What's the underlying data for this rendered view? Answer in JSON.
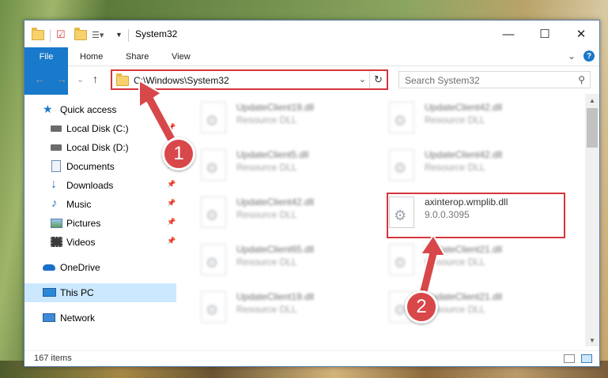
{
  "window": {
    "title": "System32",
    "controls": {
      "minimize": "—",
      "maximize": "☐",
      "close": "✕"
    }
  },
  "ribbon": {
    "tabs": [
      "File",
      "Home",
      "Share",
      "View"
    ],
    "expand": "⌄",
    "help": "?"
  },
  "nav": {
    "back": "←",
    "forward": "→",
    "recent": "⌄",
    "up": "↑"
  },
  "address": {
    "path": "C:\\Windows\\System32",
    "dropdown": "⌄",
    "refresh": "↻"
  },
  "search": {
    "placeholder": "Search System32",
    "icon": "⚲"
  },
  "sidebar": {
    "items": [
      {
        "label": "Quick access",
        "icon": "star-icon"
      },
      {
        "label": "Local Disk (C:)",
        "icon": "drive-icon",
        "pin": "📌"
      },
      {
        "label": "Local Disk (D:)",
        "icon": "drive-icon"
      },
      {
        "label": "Documents",
        "icon": "documents-icon",
        "pin": "📌"
      },
      {
        "label": "Downloads",
        "icon": "downloads-icon",
        "pin": "📌"
      },
      {
        "label": "Music",
        "icon": "music-icon",
        "pin": "📌"
      },
      {
        "label": "Pictures",
        "icon": "pictures-icon",
        "pin": "📌"
      },
      {
        "label": "Videos",
        "icon": "videos-icon",
        "pin": "📌"
      },
      {
        "label": "OneDrive",
        "icon": "onedrive-icon"
      },
      {
        "label": "This PC",
        "icon": "computer-icon",
        "selected": true
      },
      {
        "label": "Network",
        "icon": "network-icon"
      }
    ]
  },
  "files": [
    {
      "name": "UpdateClient19.dll",
      "desc": "Resource DLL"
    },
    {
      "name": "UpdateClient42.dll",
      "desc": "Resource DLL"
    },
    {
      "name": "UpdateClient5.dll",
      "desc": "Resource DLL"
    },
    {
      "name": "UpdateClient42.dll",
      "desc": "Resource DLL"
    },
    {
      "name": "UpdateClient42.dll",
      "desc": "Resource DLL"
    },
    {
      "name": "axinterop.wmplib.dll",
      "desc": "9.0.0.3095"
    },
    {
      "name": "UpdateClient65.dll",
      "desc": "Resource DLL"
    },
    {
      "name": "UpdateClient21.dll",
      "desc": "Resource DLL"
    },
    {
      "name": "UpdateClient19.dll",
      "desc": "Resource DLL"
    },
    {
      "name": "UpdateClient21.dll",
      "desc": "Resource DLL"
    }
  ],
  "status": {
    "count": "167 items"
  },
  "callouts": {
    "one": "1",
    "two": "2"
  },
  "colors": {
    "accent": "#1979ca",
    "highlight": "#d7343b",
    "selection": "#cce8ff"
  }
}
